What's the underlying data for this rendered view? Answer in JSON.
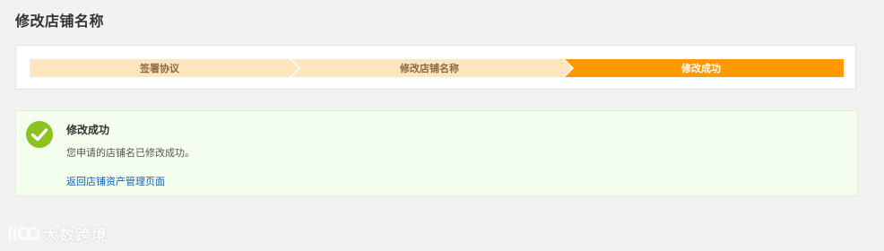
{
  "page": {
    "title": "修改店铺名称"
  },
  "steps": [
    {
      "label": "签署协议",
      "state": "done"
    },
    {
      "label": "修改店铺名称",
      "state": "done"
    },
    {
      "label": "修改成功",
      "state": "active"
    }
  ],
  "colors": {
    "step_done_bg": "#fde5c0",
    "step_done_text": "#8a6b3e",
    "step_active_bg": "#ff9900",
    "step_active_text": "#ffffff",
    "success_green": "#8cc11f",
    "link_blue": "#1a5fa8"
  },
  "result": {
    "icon": "check-circle-icon",
    "title": "修改成功",
    "message": "您申请的店铺名已修改成功。",
    "link_label": "返回店铺资产管理页面"
  },
  "watermark": {
    "text": "大数跨境"
  }
}
